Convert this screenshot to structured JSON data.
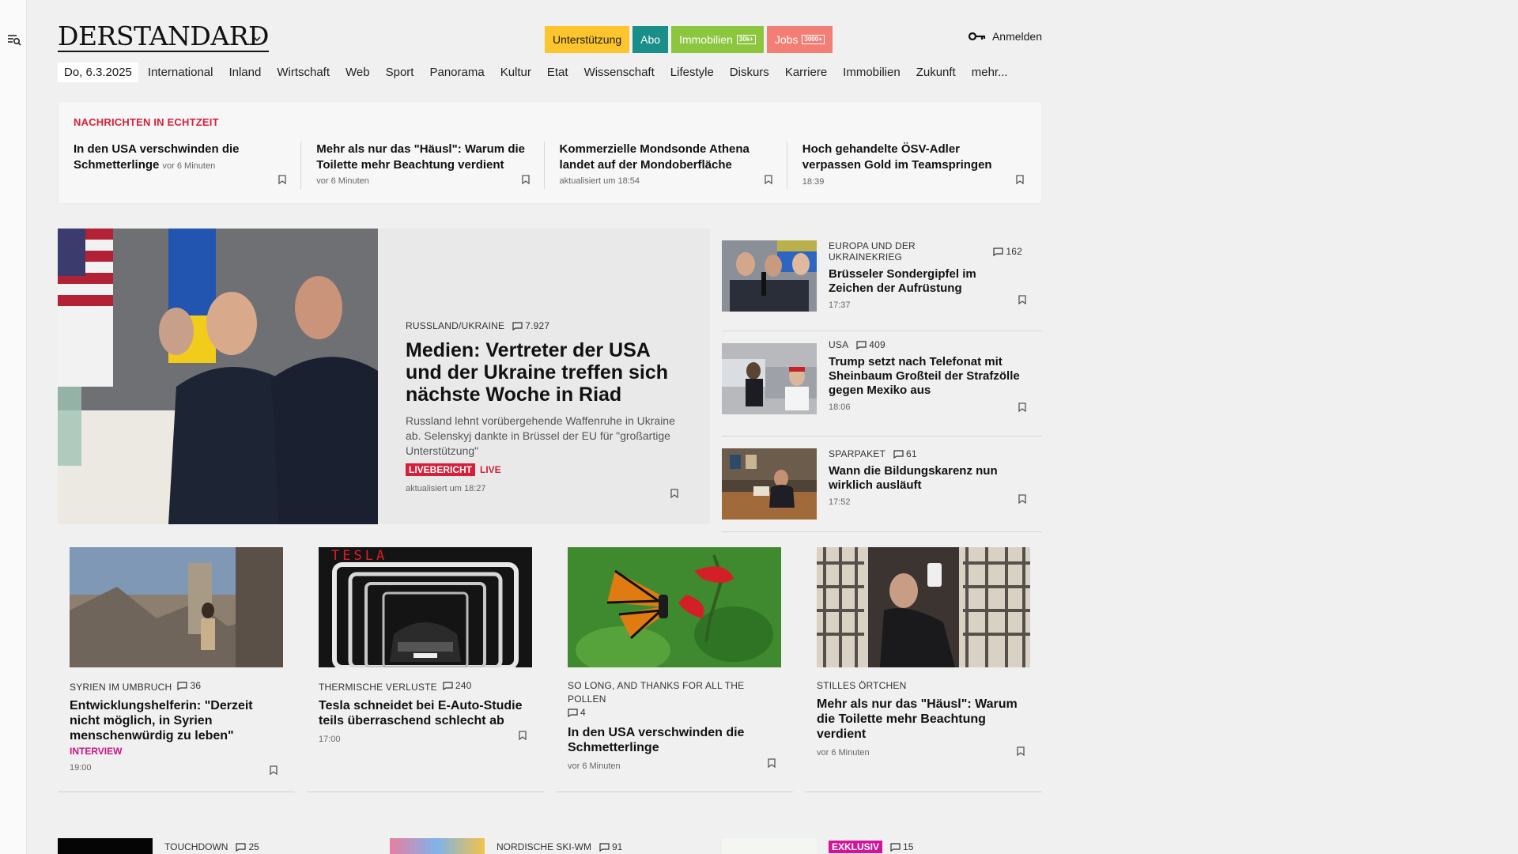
{
  "brand": {
    "logo_text": "DERSTANDARD",
    "colors": {
      "accent_red": "#d6203a",
      "unterstuetzung": "#fdc52d",
      "abo": "#1a8f8a",
      "immobilien": "#8cc63f",
      "jobs": "#f27e76",
      "interview": "#c71585",
      "exklusiv": "#d1149a"
    }
  },
  "icons": {
    "menu_search": "menu-search-icon",
    "chevron": "chevron-down-icon",
    "key": "key-icon",
    "bookmark": "bookmark-icon",
    "comment": "comment-icon"
  },
  "header": {
    "pills": [
      {
        "label": "Unterstützung",
        "tag": ""
      },
      {
        "label": "Abo",
        "tag": ""
      },
      {
        "label": "Immobilien",
        "tag": "30k+"
      },
      {
        "label": "Jobs",
        "tag": "3000+"
      }
    ],
    "login_label": "Anmelden"
  },
  "nav": {
    "date": "Do, 6.3.2025",
    "items": [
      "International",
      "Inland",
      "Wirtschaft",
      "Web",
      "Sport",
      "Panorama",
      "Kultur",
      "Etat",
      "Wissenschaft",
      "Lifestyle",
      "Diskurs",
      "Karriere",
      "Immobilien",
      "Zukunft",
      "mehr..."
    ]
  },
  "ticker": {
    "title": "NACHRICHTEN IN ECHTZEIT",
    "items": [
      {
        "headline": "In den USA verschwinden die Schmetterlinge",
        "meta": "vor 6 Minuten",
        "inline": true
      },
      {
        "headline": "Mehr als nur das \"Häusl\": Warum die Toilette mehr Beachtung verdient",
        "meta": "vor 6 Minuten",
        "inline": false
      },
      {
        "headline": "Kommerzielle Mondsonde Athena landet auf der Mondoberfläche",
        "meta": "aktualisiert um 18:54",
        "inline": false
      },
      {
        "headline": "Hoch gehandelte ÖSV-Adler verpassen Gold im Teamspringen",
        "meta": "18:39",
        "inline": true
      }
    ]
  },
  "lead": {
    "kicker": "RUSSLAND/UKRAINE",
    "comments": "7.927",
    "title": "Medien: Vertreter der USA und der Ukraine treffen sich nächste Woche in Riad",
    "teaser": "Russland lehnt vorübergehende Waffenruhe in Ukraine ab. Selenskyj dankte in Brüssel der EU für \"großartige Unterstützung\"",
    "badge": "LIVEBERICHT",
    "live": "LIVE",
    "time": "aktualisiert um 18:27"
  },
  "side": [
    {
      "kicker": "EUROPA UND DER UKRAINEKRIEG",
      "comments": "162",
      "title": "Brüsseler Sondergipfel im Zeichen der Aufrüstung",
      "time": "17:37"
    },
    {
      "kicker": "USA",
      "comments": "409",
      "title": "Trump setzt nach Telefonat mit Sheinbaum Großteil der Strafzölle gegen Mexiko aus",
      "time": "18:06"
    },
    {
      "kicker": "SPARPAKET",
      "comments": "61",
      "title": "Wann die Bildungskarenz nun wirklich ausläuft",
      "time": "17:52"
    }
  ],
  "grid": [
    {
      "kicker": "SYRIEN IM UMBRUCH",
      "comments": "36",
      "title": "Entwicklungshelferin: \"Derzeit nicht möglich, in Syrien menschenwürdig zu leben\"",
      "label": "INTERVIEW",
      "time": "19:00"
    },
    {
      "kicker": "THERMISCHE VERLUSTE",
      "comments": "240",
      "title": "Tesla schneidet bei E-Auto-Studie teils überraschend schlecht ab",
      "label": "",
      "time": "17:00",
      "image_text": "TESLA"
    },
    {
      "kicker": "SO LONG, AND THANKS FOR ALL THE POLLEN",
      "comments": "4",
      "title": "In den USA verschwinden die Schmetterlinge",
      "label": "",
      "time": "vor 6 Minuten"
    },
    {
      "kicker": "STILLES ÖRTCHEN",
      "comments": "",
      "title": "Mehr als nur das \"Häusl\": Warum die Toilette mehr Beachtung verdient",
      "label": "",
      "time": "vor 6 Minuten"
    }
  ],
  "bottom": [
    {
      "kicker": "TOUCHDOWN",
      "comments": "25",
      "badge": ""
    },
    {
      "kicker": "NORDISCHE SKI-WM",
      "comments": "91",
      "badge": ""
    },
    {
      "kicker": "",
      "comments": "15",
      "badge": "EXKLUSIV"
    }
  ]
}
